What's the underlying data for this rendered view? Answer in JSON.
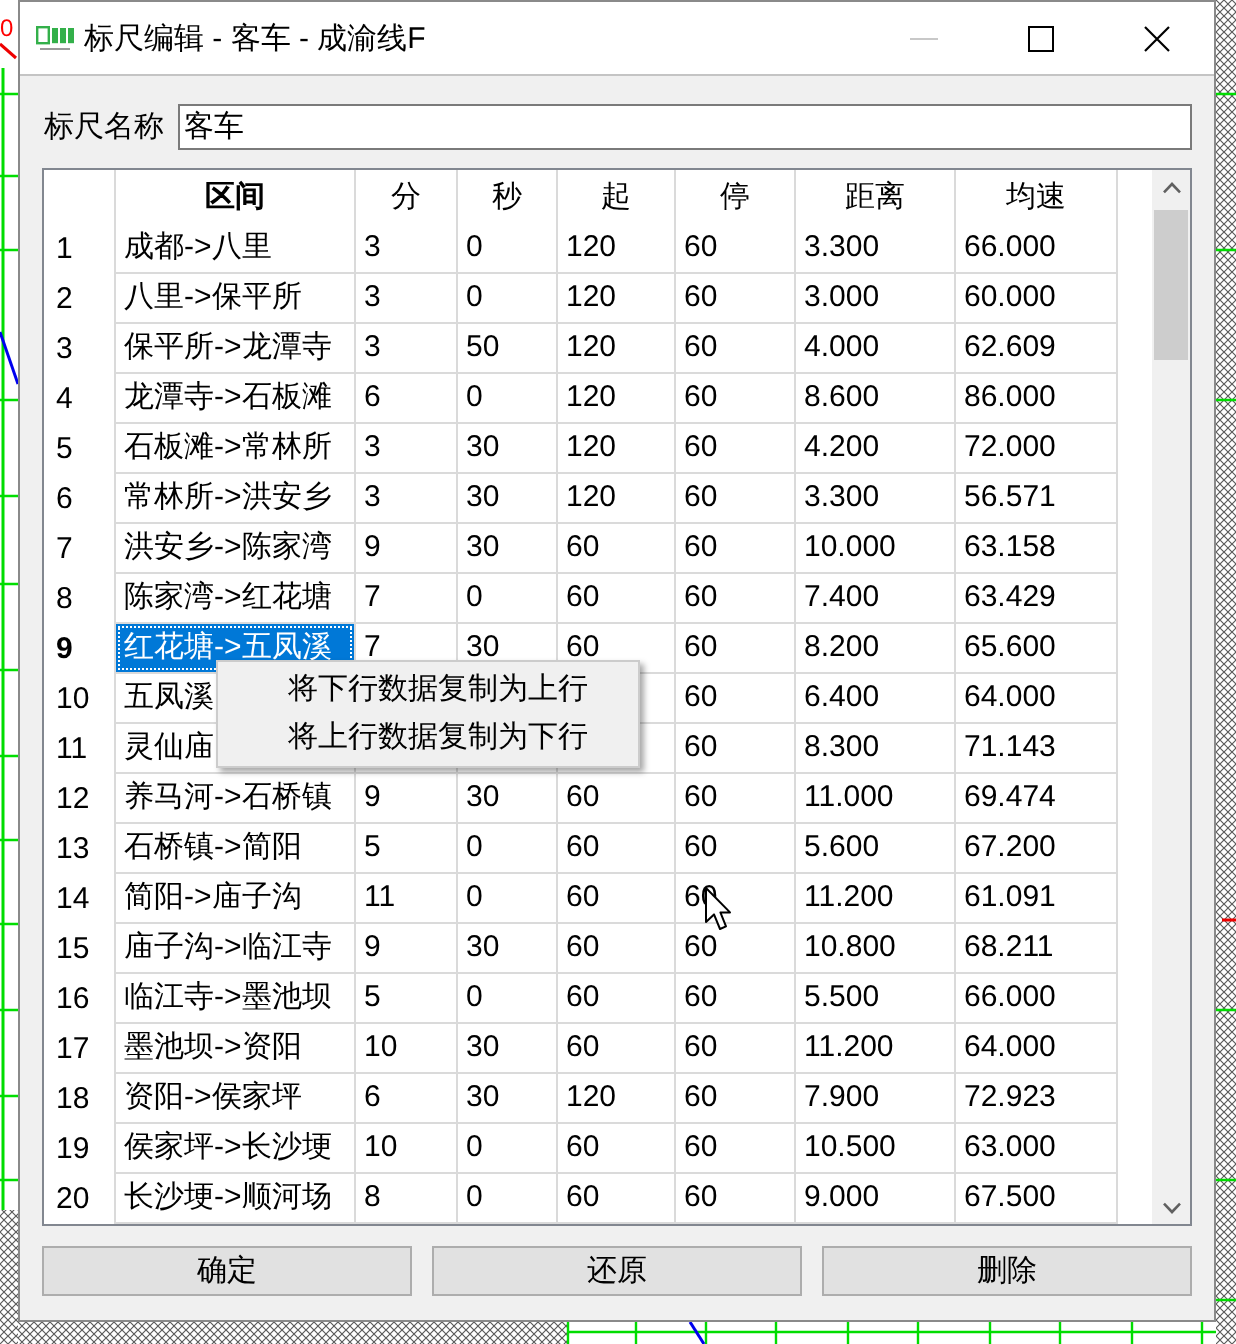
{
  "background": {
    "label": "0"
  },
  "window": {
    "title": "标尺编辑 - 客车 - 成渝线F",
    "controls": [
      {
        "kind": "minimize",
        "disabled": true
      },
      {
        "kind": "maximize",
        "disabled": false
      },
      {
        "kind": "close",
        "disabled": false
      }
    ]
  },
  "name_field": {
    "label": "标尺名称",
    "value": "客车"
  },
  "table": {
    "columns": [
      {
        "label": "区间",
        "selected": true
      },
      {
        "label": "分",
        "selected": false
      },
      {
        "label": "秒",
        "selected": false
      },
      {
        "label": "起",
        "selected": false
      },
      {
        "label": "停",
        "selected": false
      },
      {
        "label": "距离",
        "selected": false
      },
      {
        "label": "均速",
        "selected": false
      }
    ],
    "rows": [
      {
        "index": "1",
        "selected": false,
        "cells": [
          "成都->八里",
          "3",
          "0",
          "120",
          "60",
          "3.300",
          "66.000"
        ]
      },
      {
        "index": "2",
        "selected": false,
        "cells": [
          "八里->保平所",
          "3",
          "0",
          "120",
          "60",
          "3.000",
          "60.000"
        ]
      },
      {
        "index": "3",
        "selected": false,
        "cells": [
          "保平所->龙潭寺",
          "3",
          "50",
          "120",
          "60",
          "4.000",
          "62.609"
        ]
      },
      {
        "index": "4",
        "selected": false,
        "cells": [
          "龙潭寺->石板滩",
          "6",
          "0",
          "120",
          "60",
          "8.600",
          "86.000"
        ]
      },
      {
        "index": "5",
        "selected": false,
        "cells": [
          "石板滩->常林所",
          "3",
          "30",
          "120",
          "60",
          "4.200",
          "72.000"
        ]
      },
      {
        "index": "6",
        "selected": false,
        "cells": [
          "常林所->洪安乡",
          "3",
          "30",
          "120",
          "60",
          "3.300",
          "56.571"
        ]
      },
      {
        "index": "7",
        "selected": false,
        "cells": [
          "洪安乡->陈家湾",
          "9",
          "30",
          "60",
          "60",
          "10.000",
          "63.158"
        ]
      },
      {
        "index": "8",
        "selected": false,
        "cells": [
          "陈家湾->红花塘",
          "7",
          "0",
          "60",
          "60",
          "7.400",
          "63.429"
        ]
      },
      {
        "index": "9",
        "selected": true,
        "cells": [
          "红花塘->五凤溪",
          "7",
          "30",
          "60",
          "60",
          "8.200",
          "65.600"
        ]
      },
      {
        "index": "10",
        "selected": false,
        "cells": [
          "五凤溪",
          null,
          null,
          null,
          "60",
          "6.400",
          "64.000"
        ]
      },
      {
        "index": "11",
        "selected": false,
        "cells": [
          "灵仙庙",
          null,
          null,
          null,
          "60",
          "8.300",
          "71.143"
        ]
      },
      {
        "index": "12",
        "selected": false,
        "cells": [
          "养马河->石桥镇",
          "9",
          "30",
          "60",
          "60",
          "11.000",
          "69.474"
        ]
      },
      {
        "index": "13",
        "selected": false,
        "cells": [
          "石桥镇->简阳",
          "5",
          "0",
          "60",
          "60",
          "5.600",
          "67.200"
        ]
      },
      {
        "index": "14",
        "selected": false,
        "cells": [
          "简阳->庙子沟",
          "11",
          "0",
          "60",
          "60",
          "11.200",
          "61.091"
        ]
      },
      {
        "index": "15",
        "selected": false,
        "cells": [
          "庙子沟->临江寺",
          "9",
          "30",
          "60",
          "60",
          "10.800",
          "68.211"
        ]
      },
      {
        "index": "16",
        "selected": false,
        "cells": [
          "临江寺->墨池坝",
          "5",
          "0",
          "60",
          "60",
          "5.500",
          "66.000"
        ]
      },
      {
        "index": "17",
        "selected": false,
        "cells": [
          "墨池坝->资阳",
          "10",
          "30",
          "60",
          "60",
          "11.200",
          "64.000"
        ]
      },
      {
        "index": "18",
        "selected": false,
        "cells": [
          "资阳->侯家坪",
          "6",
          "30",
          "120",
          "60",
          "7.900",
          "72.923"
        ]
      },
      {
        "index": "19",
        "selected": false,
        "cells": [
          "侯家坪->长沙埂",
          "10",
          "0",
          "60",
          "60",
          "10.500",
          "63.000"
        ]
      },
      {
        "index": "20",
        "selected": false,
        "cells": [
          "长沙埂->顺河场",
          "8",
          "0",
          "60",
          "60",
          "9.000",
          "67.500"
        ]
      }
    ]
  },
  "context_menu": {
    "items": [
      "将下行数据复制为上行",
      "将上行数据复制为下行"
    ]
  },
  "buttons": [
    "确定",
    "还原",
    "删除"
  ]
}
